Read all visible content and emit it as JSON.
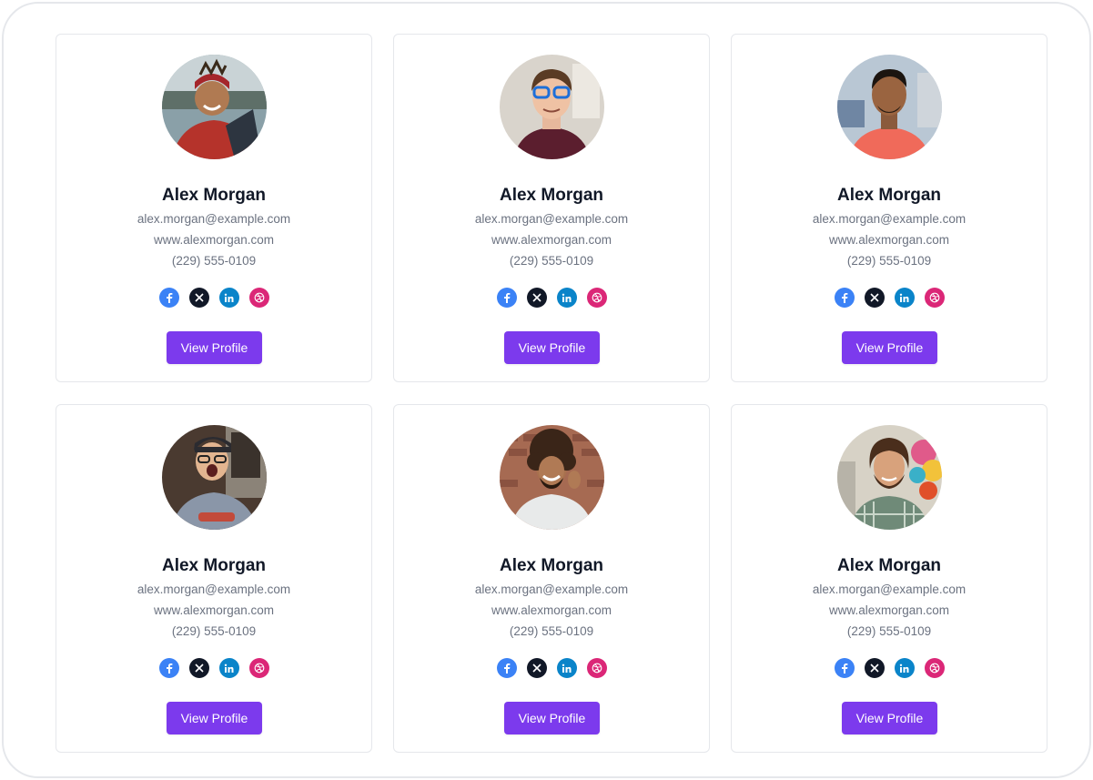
{
  "colors": {
    "accent": "#7c3aed",
    "facebook": "#3b82f6",
    "x": "#111827",
    "linkedin": "#0a84c9",
    "dribbble": "#db2777"
  },
  "social_icons": [
    "facebook-icon",
    "x-icon",
    "linkedin-icon",
    "dribbble-icon"
  ],
  "cards": [
    {
      "name": "Alex Morgan",
      "email": "alex.morgan@example.com",
      "website": "www.alexmorgan.com",
      "phone": "(229) 555-0109",
      "button_label": "View Profile"
    },
    {
      "name": "Alex Morgan",
      "email": "alex.morgan@example.com",
      "website": "www.alexmorgan.com",
      "phone": "(229) 555-0109",
      "button_label": "View Profile"
    },
    {
      "name": "Alex Morgan",
      "email": "alex.morgan@example.com",
      "website": "www.alexmorgan.com",
      "phone": "(229) 555-0109",
      "button_label": "View Profile"
    },
    {
      "name": "Alex Morgan",
      "email": "alex.morgan@example.com",
      "website": "www.alexmorgan.com",
      "phone": "(229) 555-0109",
      "button_label": "View Profile"
    },
    {
      "name": "Alex Morgan",
      "email": "alex.morgan@example.com",
      "website": "www.alexmorgan.com",
      "phone": "(229) 555-0109",
      "button_label": "View Profile"
    },
    {
      "name": "Alex Morgan",
      "email": "alex.morgan@example.com",
      "website": "www.alexmorgan.com",
      "phone": "(229) 555-0109",
      "button_label": "View Profile"
    }
  ]
}
